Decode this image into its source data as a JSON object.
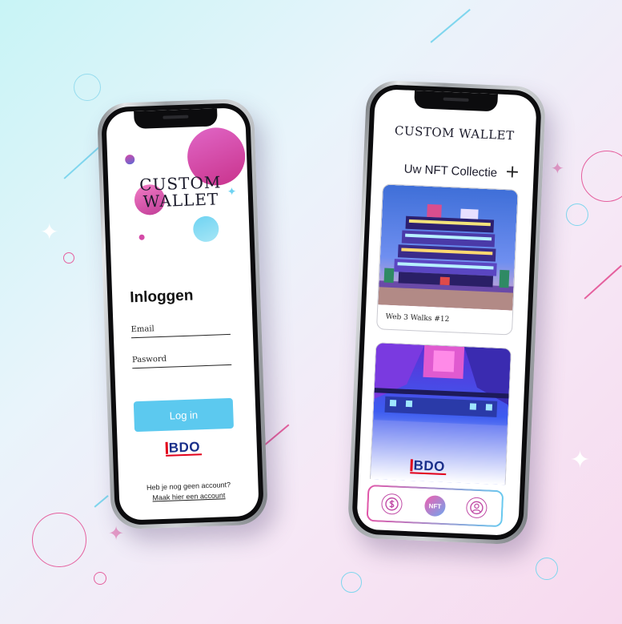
{
  "login_screen": {
    "logo_line1": "CUSTOM",
    "logo_line2": "WALLET",
    "title": "Inloggen",
    "email_placeholder": "Email",
    "password_placeholder": "Pasword",
    "login_button": "Log in",
    "brand": "BDO",
    "signup_question": "Heb je nog geen account?",
    "signup_link": "Maak hier een account"
  },
  "collection_screen": {
    "logo": "CUSTOM WALLET",
    "title": "Uw NFT Collectie",
    "add_button": "+",
    "cards": [
      {
        "title": "Web 3 Walks #12"
      }
    ],
    "brand": "BDO",
    "nav": {
      "wallet_icon": "dollar-icon",
      "nft_label": "NFT",
      "profile_icon": "user-icon"
    }
  },
  "colors": {
    "accent_blue": "#5cc9ef",
    "accent_pink": "#e057a9",
    "bdo_blue": "#1a2f8a",
    "bdo_red": "#e2001a"
  }
}
